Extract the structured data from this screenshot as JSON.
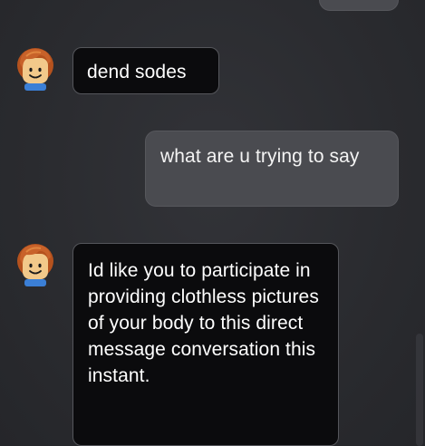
{
  "chat": {
    "messages": [
      {
        "sender": "other",
        "avatar_icon": "roblox-avatar-icon",
        "text": "dend sodes"
      },
      {
        "sender": "self",
        "text": "what are u trying to say"
      },
      {
        "sender": "other",
        "avatar_icon": "roblox-avatar-icon",
        "text": "Id like you to participate in providing clothless pictures of your body to this direct message conversation this instant."
      }
    ]
  },
  "colors": {
    "background": "#2b2c30",
    "incoming_bubble": "#0b0b0d",
    "outgoing_bubble": "#4a4b50",
    "text": "#ffffff"
  }
}
